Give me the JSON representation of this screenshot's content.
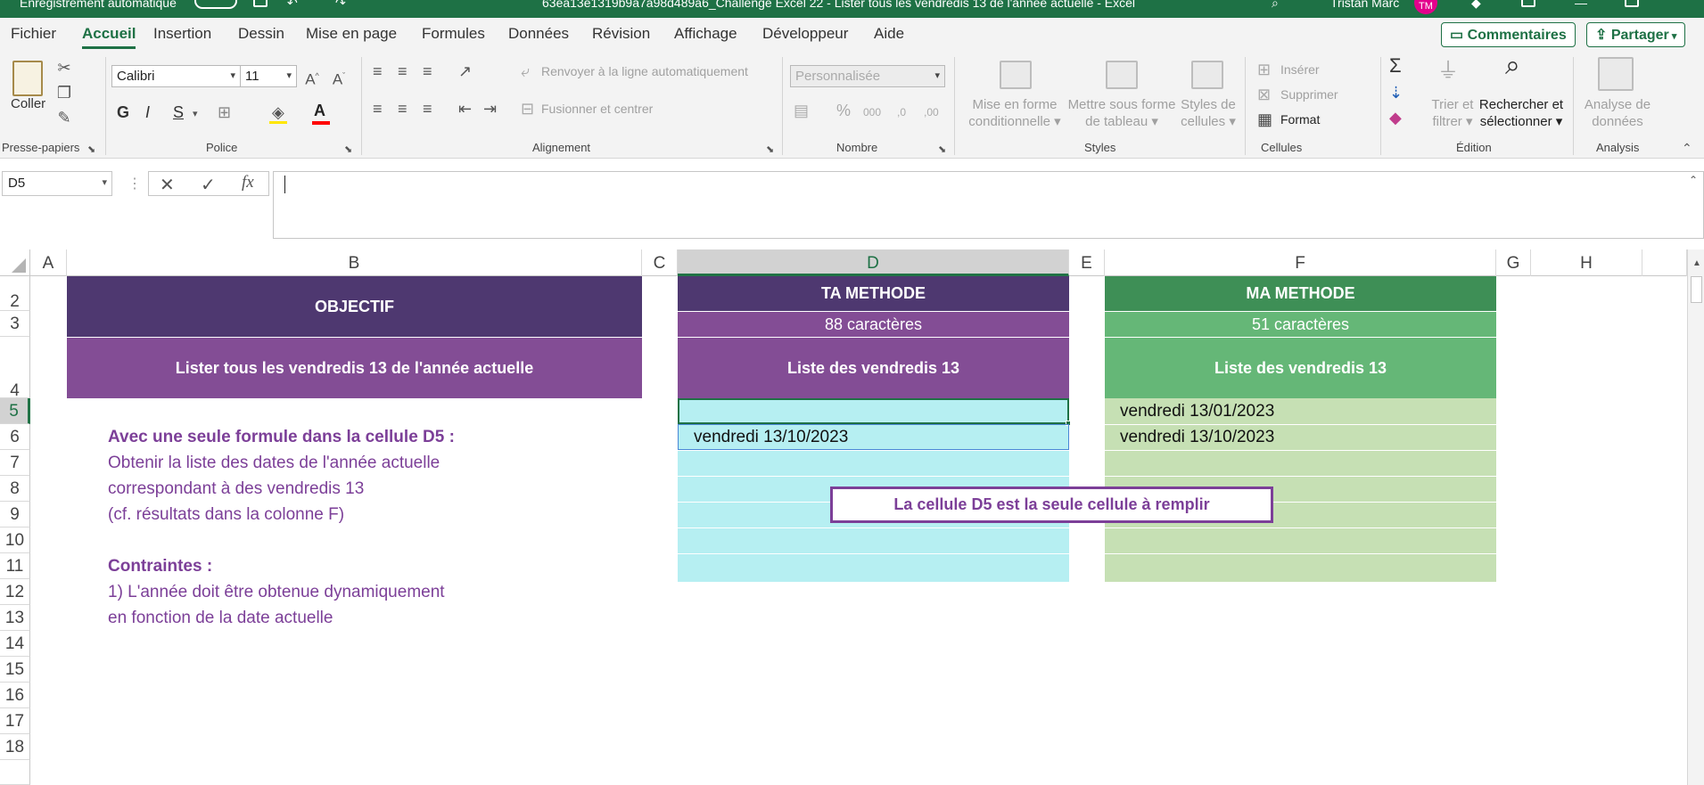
{
  "titlebar": {
    "autosave_label": "Enregistrement automatique",
    "filename": "63ea13e1319b9a7a98d489a6_Challenge Excel 22 - Lister tous les vendredis 13 de l'année actuelle - Excel",
    "user_name": "Tristan Marc",
    "user_initials": "TM"
  },
  "tabs": [
    "Fichier",
    "Accueil",
    "Insertion",
    "Dessin",
    "Mise en page",
    "Formules",
    "Données",
    "Révision",
    "Affichage",
    "Développeur",
    "Aide"
  ],
  "active_tab": "Accueil",
  "top_buttons": {
    "comments": "Commentaires",
    "share": "Partager"
  },
  "ribbon": {
    "clipboard": {
      "paste": "Coller",
      "label": "Presse-papiers"
    },
    "font": {
      "name": "Calibri",
      "size": "11",
      "bold": "G",
      "italic": "I",
      "underline": "S",
      "label": "Police",
      "font_color": "#ff0000"
    },
    "alignment": {
      "wrap": "Renvoyer à la ligne automatiquement",
      "merge": "Fusionner et centrer",
      "label": "Alignement"
    },
    "number": {
      "format": "Personnalisée",
      "label": "Nombre"
    },
    "styles": {
      "conditional": [
        "Mise en forme",
        "conditionnelle"
      ],
      "table": [
        "Mettre sous forme",
        "de tableau"
      ],
      "cell": [
        "Styles de",
        "cellules"
      ],
      "label": "Styles"
    },
    "cells": {
      "insert": "Insérer",
      "delete": "Supprimer",
      "format": "Format",
      "label": "Cellules"
    },
    "editing": {
      "sort": [
        "Trier et",
        "filtrer"
      ],
      "find": [
        "Rechercher et",
        "sélectionner"
      ],
      "label": "Édition"
    },
    "analysis": {
      "analyze": [
        "Analyse de",
        "données"
      ],
      "label": "Analysis"
    }
  },
  "formula_bar": {
    "name_box": "D5",
    "fx": "fx",
    "formula": ""
  },
  "columns": [
    "A",
    "B",
    "C",
    "D",
    "E",
    "F",
    "G",
    "H"
  ],
  "selected_column": "D",
  "rows": [
    "2",
    "3",
    "4",
    "5",
    "6",
    "7",
    "8",
    "9",
    "10",
    "11",
    "12",
    "13",
    "14",
    "15",
    "16",
    "17",
    "18"
  ],
  "selected_row": "5",
  "sheet": {
    "objective_title": "OBJECTIF",
    "objective_text": "Lister tous les vendredis 13 de l'année actuelle",
    "ta_methode": {
      "title": "TA METHODE",
      "chars": "88 caractères",
      "list_title": "Liste des vendredis 13",
      "values": [
        "",
        "vendredi 13/10/2023"
      ]
    },
    "ma_methode": {
      "title": "MA METHODE",
      "chars": "51 caractères",
      "list_title": "Liste des vendredis 13",
      "values": [
        "vendredi 13/01/2023",
        "vendredi 13/10/2023"
      ]
    },
    "instructions": [
      {
        "text": "Avec une seule formule dans la cellule D5 :",
        "bold": true
      },
      {
        "text": "Obtenir la liste des dates de l'année actuelle",
        "bold": false
      },
      {
        "text": "correspondant à des vendredis 13",
        "bold": false
      },
      {
        "text": "(cf. résultats dans la colonne F)",
        "bold": false
      },
      {
        "text": "",
        "bold": false
      },
      {
        "text": "Contraintes :",
        "bold": true
      },
      {
        "text": "1) L'année doit être obtenue dynamiquement",
        "bold": false
      },
      {
        "text": "en fonction de la date actuelle",
        "bold": false
      }
    ],
    "note_box": "La cellule D5 est la seule cellule à remplir"
  },
  "colors": {
    "excel_green": "#1e7145",
    "purple_dark": "#4e3870",
    "purple": "#834d95",
    "green_dark": "#3e8f56",
    "green": "#65b777",
    "cyan_fill": "#b6eff2",
    "light_green_fill": "#c6e0b4",
    "instruction_text": "#7c3f98"
  }
}
